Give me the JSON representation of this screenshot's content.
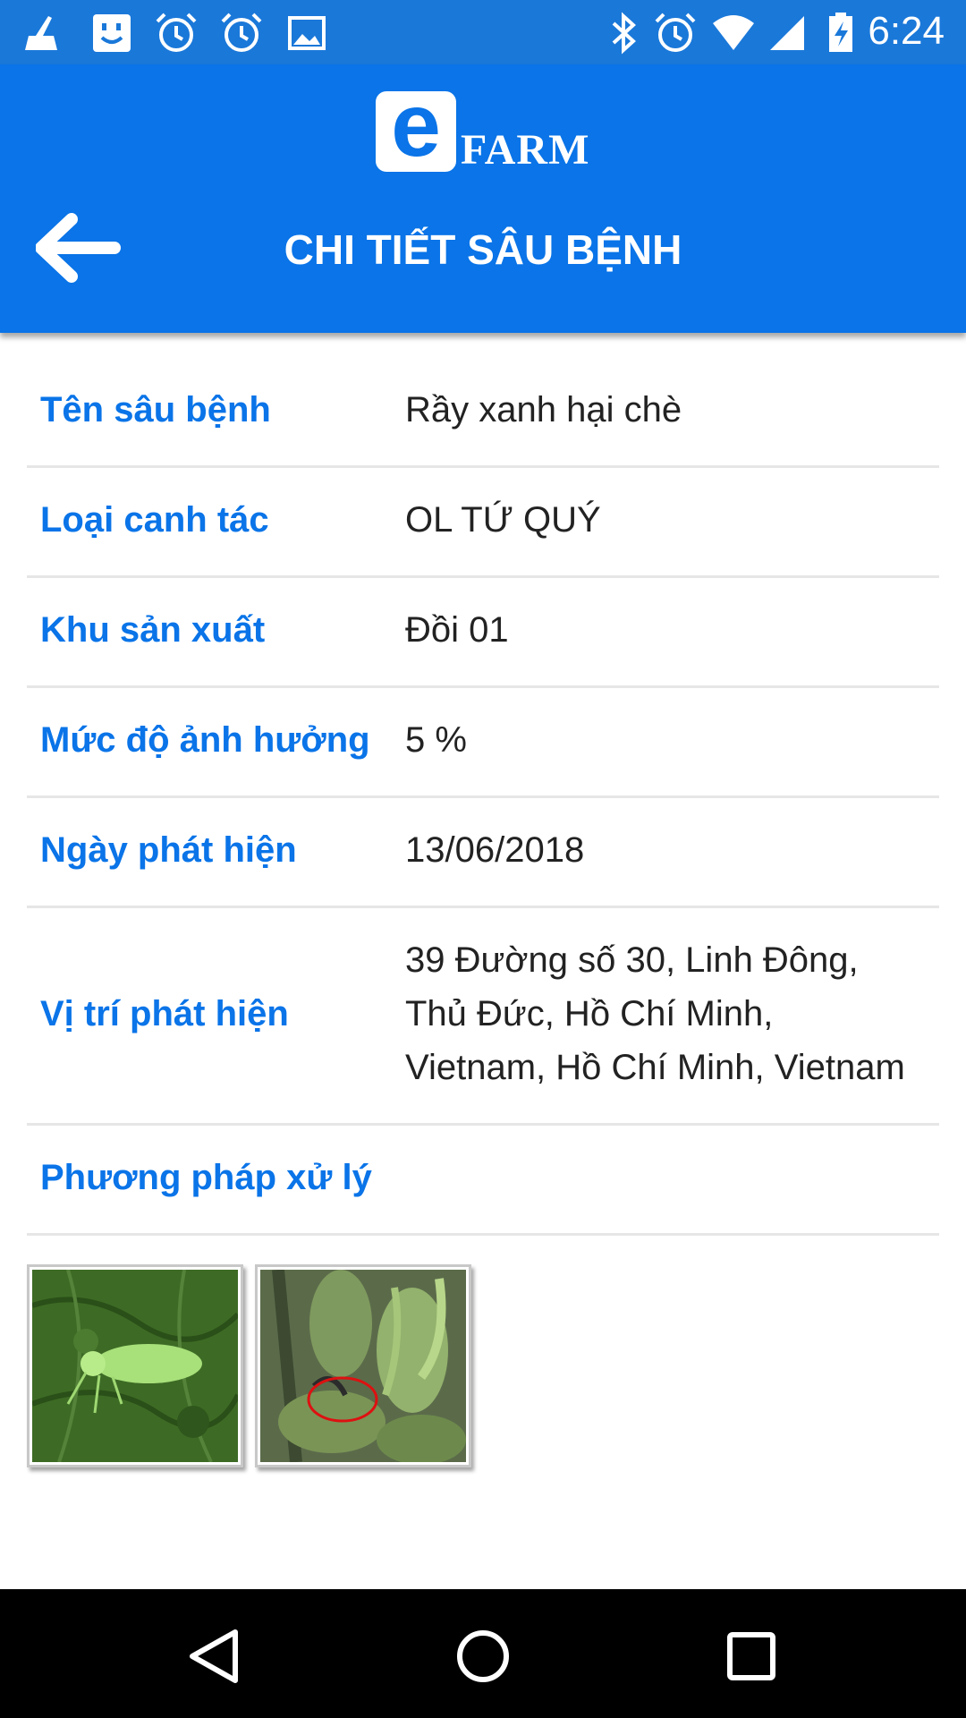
{
  "status_bar": {
    "time": "6:24",
    "icons": [
      "cleaner-icon",
      "face-app-icon",
      "alarm-icon",
      "alarm-icon",
      "image-icon",
      "bluetooth-icon",
      "alarm-icon",
      "wifi-icon",
      "signal-icon",
      "battery-charging-icon"
    ]
  },
  "header": {
    "logo_e": "e",
    "logo_text": "FARM",
    "title": "CHI TIẾT SÂU BỆNH",
    "back_icon": "arrow-left-icon",
    "color": "#0a74e8"
  },
  "details": [
    {
      "label": "Tên sâu bệnh",
      "value": "Rầy xanh hại chè"
    },
    {
      "label": "Loại canh tác",
      "value": "OL TỨ QUÝ"
    },
    {
      "label": "Khu sản xuất",
      "value": "Đồi 01"
    },
    {
      "label": "Mức độ ảnh hưởng",
      "value": "5 %"
    },
    {
      "label": "Ngày phát hiện",
      "value": "13/06/2018"
    },
    {
      "label": "Vị trí phát hiện",
      "value_lines": [
        "39 Đường số 30, Linh Đông,",
        "Thủ Đức, Hồ Chí Minh,",
        "Vietnam, Hồ Chí Minh, Vietnam"
      ]
    },
    {
      "label": "Phương pháp xử lý",
      "value": ""
    }
  ],
  "photos": [
    "leafhopper-photo",
    "tea-plant-damage-photo"
  ],
  "nav_bar": [
    "back-triangle-icon",
    "home-circle-icon",
    "recents-square-icon"
  ]
}
